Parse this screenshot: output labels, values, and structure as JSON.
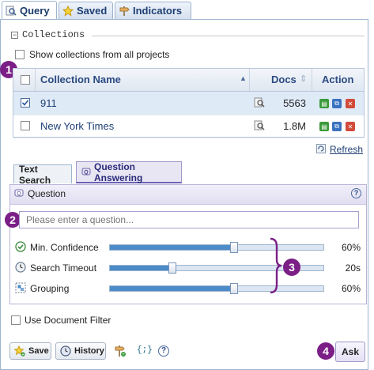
{
  "tabs": [
    {
      "label": "Query",
      "icon": "magnifier-icon",
      "active": true
    },
    {
      "label": "Saved",
      "icon": "star-icon",
      "active": false
    },
    {
      "label": "Indicators",
      "icon": "signpost-icon",
      "active": false
    }
  ],
  "collections": {
    "section_title": "Collections",
    "show_all_label": "Show collections from all projects",
    "show_all_checked": false,
    "columns": {
      "name": "Collection Name",
      "docs": "Docs",
      "action": "Action"
    },
    "rows": [
      {
        "name": "911",
        "docs": "5563",
        "checked": true
      },
      {
        "name": "New York Times",
        "docs": "1.8M",
        "checked": false
      }
    ],
    "refresh_label": "Refresh"
  },
  "subtabs": [
    {
      "label": "Text Search",
      "active": false
    },
    {
      "label": "Question Answering",
      "active": true
    }
  ],
  "question": {
    "title": "Question",
    "placeholder": "Please enter a question...",
    "help": "?"
  },
  "sliders": [
    {
      "label": "Min. Confidence",
      "value_text": "60%",
      "fraction": 0.6,
      "icon": "check-circle-icon"
    },
    {
      "label": "Search Timeout",
      "value_text": "20s",
      "fraction": 0.3,
      "icon": "clock-icon"
    },
    {
      "label": "Grouping",
      "value_text": "60%",
      "fraction": 0.6,
      "icon": "grouping-icon"
    }
  ],
  "doc_filter_label": "Use Document Filter",
  "footer": {
    "save": "Save",
    "history": "History",
    "json_icon": "{;}",
    "help": "?",
    "ask": "Ask"
  },
  "badges": [
    "1",
    "2",
    "3",
    "4"
  ],
  "colors": {
    "badge": "#7b1f86",
    "link": "#1e3f73",
    "slider_fill": "#4b8bc7"
  }
}
